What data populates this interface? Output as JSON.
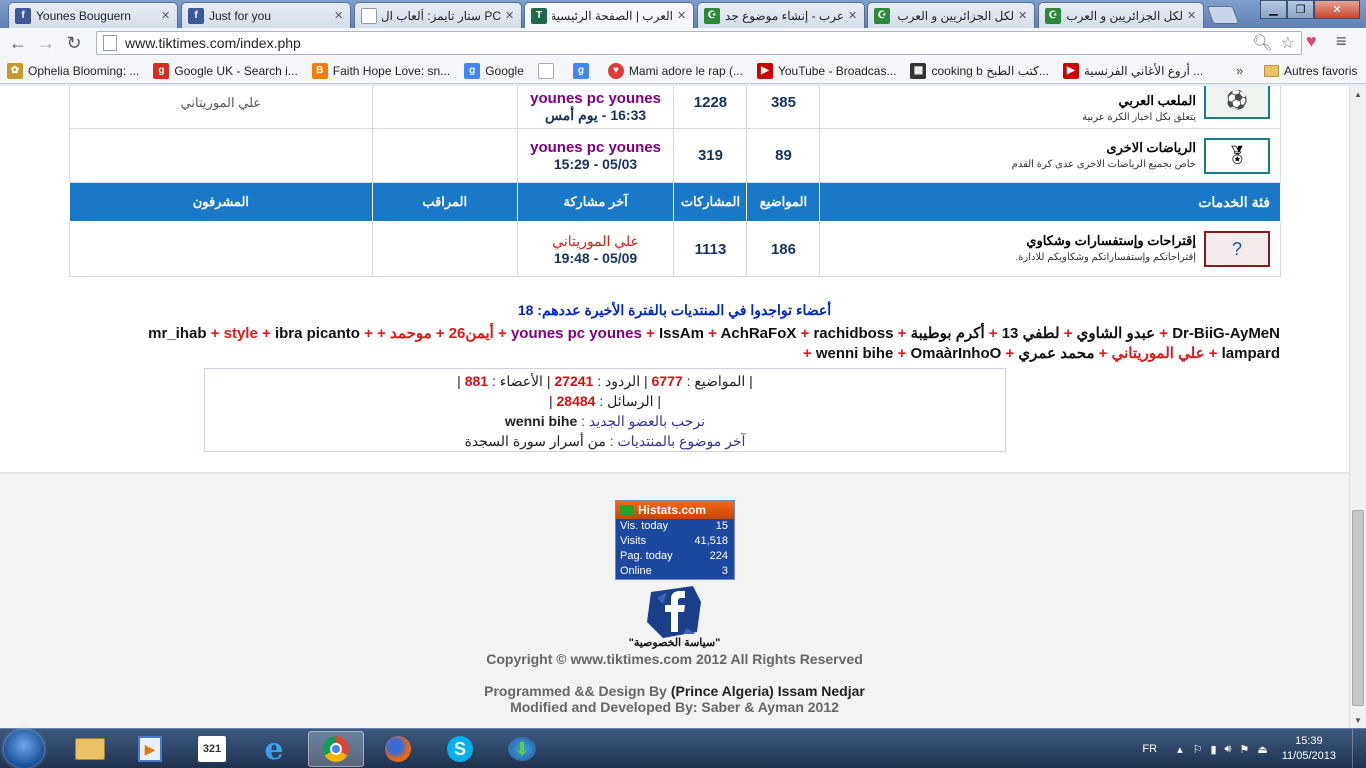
{
  "browser": {
    "tabs": [
      {
        "title": "Younes Bouguern",
        "icon": "facebook-icon",
        "color": "#3b5998",
        "glyph": "f"
      },
      {
        "title": "Just for you",
        "icon": "facebook-icon",
        "color": "#3b5998",
        "glyph": "f"
      },
      {
        "title": "PC ستار تايمز: ألعاب ال",
        "icon": "page-icon",
        "color": "#ffffff",
        "glyph": ""
      },
      {
        "title": "العرب | الصفحة الرئيسية",
        "icon": "tiktimes-icon",
        "color": "#1c6a4a",
        "glyph": "T"
      },
      {
        "title": "عرب - إنشاء موضوع جديد",
        "icon": "algeria-flag-icon",
        "color": "#c0392b",
        "glyph": "☪"
      },
      {
        "title": "لكل الجزائريين و العرب",
        "icon": "algeria-flag-icon",
        "color": "#c0392b",
        "glyph": "☪"
      },
      {
        "title": "لكل الجزائريين و العرب",
        "icon": "algeria-flag-icon",
        "color": "#c0392b",
        "glyph": "☪"
      }
    ],
    "url": "www.tiktimes.com/index.php",
    "bookmarks": [
      {
        "label": "Ophelia Blooming: ...",
        "color": "#c79a2a",
        "glyph": "✿"
      },
      {
        "label": "Google UK - Search i...",
        "color": "#d62d20",
        "glyph": "g"
      },
      {
        "label": "Faith Hope Love: sn...",
        "color": "#f57d00",
        "glyph": "B"
      },
      {
        "label": "Google",
        "color": "#4285f4",
        "glyph": "g"
      },
      {
        "label": "",
        "color": "#ffffff",
        "glyph": ""
      },
      {
        "label": "",
        "color": "#4285f4",
        "glyph": "g"
      },
      {
        "label": "Mami adore le rap (...",
        "color": "#e03a3a",
        "glyph": "♥"
      },
      {
        "label": "YouTube - Broadcas...",
        "color": "#cc0000",
        "glyph": "▶"
      },
      {
        "label": "cooking b كتب الطبخ...",
        "color": "#333333",
        "glyph": "▦"
      },
      {
        "label": "أروع الأغاني الفرنسية ...",
        "color": "#cc0000",
        "glyph": "▶"
      }
    ],
    "more": "»",
    "other_bookmarks": "Autres favoris"
  },
  "forum": {
    "rows_top": [
      {
        "title": "الملعب العربي",
        "desc": "يتعلق بكل اخبار الكرة عربية",
        "topics": "385",
        "posts": "1228",
        "last_user": "younes pc younes",
        "last_date": "16:33 - يوم أمس",
        "moderator": "",
        "supervisors": "علي الموريتاني"
      },
      {
        "title": "الرياضات الاخرى",
        "desc": "خاص بجميع الرياضات الاخرى عدى كرة القدم",
        "topics": "89",
        "posts": "319",
        "last_user": "younes pc younes",
        "last_date": "05/03 - 15:29",
        "moderator": "",
        "supervisors": ""
      }
    ],
    "header": {
      "category": "فئة الخدمات",
      "topics": "المواضيع",
      "posts": "المشاركات",
      "last_post": "آخر مشاركة",
      "moderator": "المراقب",
      "supervisors": "المشرفون"
    },
    "rows_bottom": [
      {
        "title": "إقتراحات وإستفسارات وشكاوي",
        "desc": "إقتراحاتكم وإستفساراتكم وشكاويكم للادارة.",
        "topics": "186",
        "posts": "1113",
        "last_user": "علي الموريتاني",
        "last_date": "05/09 - 19:48",
        "moderator": "",
        "supervisors": ""
      }
    ]
  },
  "online": {
    "title": "أعضاء تواجدوا في المنتديات بالفترة الأخيرة عددهم: 18",
    "members": [
      {
        "name": "Dr-BiiG-AyMeN",
        "style": "normal"
      },
      {
        "name": "عبدو الشاوي",
        "style": "normal"
      },
      {
        "name": "لطفي 13",
        "style": "normal"
      },
      {
        "name": "أكرم بوطيبة",
        "style": "normal"
      },
      {
        "name": "younes pc younes",
        "style": "purple"
      },
      {
        "name": "IssAm",
        "style": "normal"
      },
      {
        "name": "AchRaFoX",
        "style": "normal"
      },
      {
        "name": "rachidboss",
        "style": "normal"
      },
      {
        "name": "أيمن26",
        "style": "red"
      },
      {
        "name": "موحمد",
        "style": "red"
      },
      {
        "name": "",
        "style": "normal"
      },
      {
        "name": "mr_ihab",
        "style": "normal"
      },
      {
        "name": "style",
        "style": "red"
      },
      {
        "name": "ibra picanto",
        "style": "normal"
      },
      {
        "name": "lampard",
        "style": "normal"
      },
      {
        "name": "علي الموريتاني",
        "style": "red"
      },
      {
        "name": "محمد عمري",
        "style": "normal"
      },
      {
        "name": "wenni bihe",
        "style": "normal"
      },
      {
        "name": "OmaàrInhoO",
        "style": "normal"
      }
    ]
  },
  "stats": {
    "topics_label": "المواضيع :",
    "topics": "6777",
    "replies_label": "الردود :",
    "replies": "27241",
    "members_label": "الأعضاء :",
    "members": "881",
    "messages_label": "الرسائل :",
    "messages": "28484",
    "welcome_label": "نرحب بالعضو الجديد :",
    "welcome_user": "wenni bihe",
    "last_topic_label": "آخر موضوع بالمنتديات :",
    "last_topic": "من أسرار سورة السجدة"
  },
  "footer": {
    "histats": {
      "brand": "Histats.com",
      "rows": [
        {
          "label": "Vis. today",
          "value": "15"
        },
        {
          "label": "Visits",
          "value": "41,518"
        },
        {
          "label": "Pag. today",
          "value": "224"
        },
        {
          "label": "Online",
          "value": "3"
        }
      ]
    },
    "privacy": "\"سياسة الخصوصية\"",
    "copyright": "Copyright © www.tiktimes.com 2012 All Rights Reserved",
    "programmed_prefix": "Programmed && Design By",
    "programmed_by": "(Prince Algeria) Issam Nedjar",
    "modified": "Modified and Developed By: Saber & Ayman 2012"
  },
  "taskbar": {
    "lang": "FR",
    "time": "15:39",
    "date": "11/05/2013"
  }
}
